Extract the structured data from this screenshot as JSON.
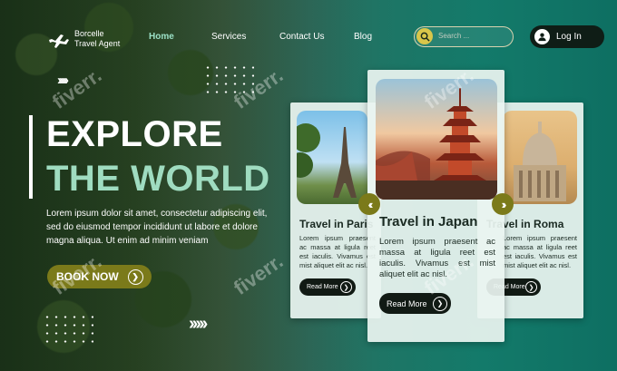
{
  "brand": {
    "line1": "Borcelle",
    "line2": "Travel Agent",
    "icon": "airplane-icon"
  },
  "nav": {
    "items": [
      "Home",
      "Services",
      "Contact Us",
      "Blog"
    ],
    "active": "Home"
  },
  "search": {
    "placeholder": "Search ...",
    "icon": "search-icon"
  },
  "login": {
    "label": "Log In",
    "icon": "user-icon"
  },
  "hero": {
    "title_line1": "EXPLORE",
    "title_line2": "THE WORLD",
    "description": "Lorem ipsum dolor sit amet, consectetur adipiscing elit, sed do eiusmod tempor incididunt ut labore et dolore magna aliqua. Ut enim ad minim veniam",
    "cta": "BOOK NOW"
  },
  "cards": [
    {
      "title": "Travel in Paris",
      "body": "Lorem ipsum praesent ac massa at ligula reet est iaculis. Vivamus est mist aliquet elit ac nisl.",
      "button": "Read More"
    },
    {
      "title": "Travel in Japan",
      "body": "Lorem ipsum praesent ac massa at ligula reet est iaculis. Vivamus est mist aliquet elit ac nisl.",
      "button": "Read More"
    },
    {
      "title": "Travel in Roma",
      "body": "Lorem ipsum praesent ac massa at ligula reet est iaculis. Vivamus est mist aliquet elit ac nisl.",
      "button": "Read More"
    }
  ],
  "watermark": "fiverr.",
  "colors": {
    "accent": "#9fdcc0",
    "button": "#7b7a1a",
    "dark": "#111a14"
  }
}
